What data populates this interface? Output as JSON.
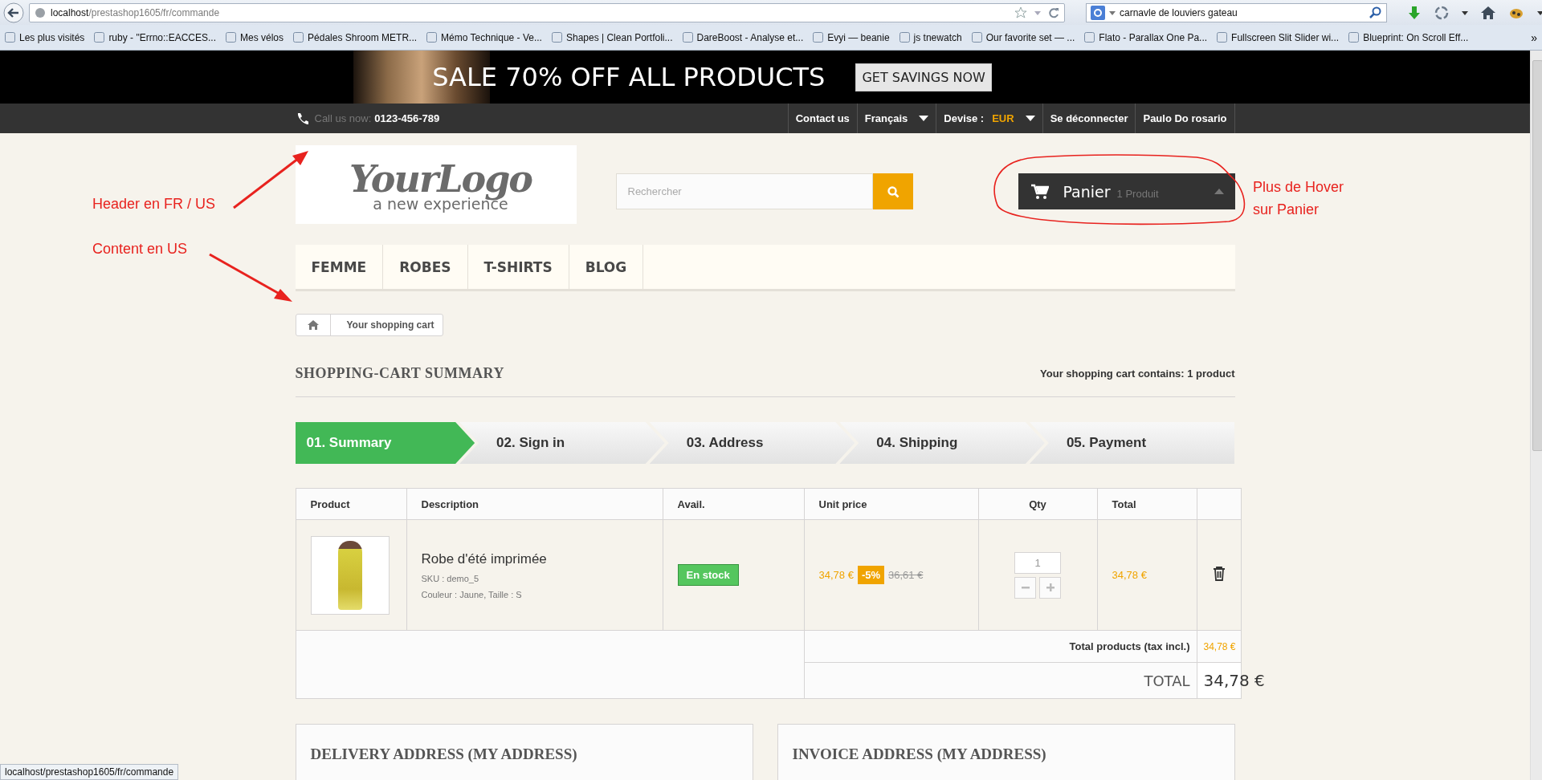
{
  "browser": {
    "url_host": "localhost",
    "url_path": "/prestashop1605/fr/commande",
    "search_query": "carnavle de louviers gateau",
    "bookmarks": [
      "Les plus visités",
      "ruby - \"Errno::EACCES...",
      "Mes vélos",
      "Pédales Shroom METR...",
      "Mémo Technique - Ve...",
      "Shapes | Clean Portfoli...",
      "DareBoost - Analyse et...",
      "Evyi — beanie",
      "js tnewatch",
      "Our favorite set — ...",
      "Flato - Parallax One Pa...",
      "Fullscreen Slit Slider wi...",
      "Blueprint: On Scroll Eff..."
    ],
    "more": "»"
  },
  "banner": {
    "text": "SALE 70% OFF ALL PRODUCTS",
    "button": "GET SAVINGS NOW"
  },
  "topbar": {
    "call_label": "Call us now:",
    "phone": "0123-456-789",
    "links": [
      {
        "kind": "link",
        "label": "Contact us"
      },
      {
        "kind": "dropdown",
        "label": "Français"
      },
      {
        "kind": "currency",
        "label": "Devise :",
        "value": "EUR"
      },
      {
        "kind": "link",
        "label": "Se déconnecter"
      },
      {
        "kind": "link",
        "label": "Paulo Do rosario"
      }
    ]
  },
  "logo": {
    "name": "YourLogo",
    "tagline": "a new experience"
  },
  "search": {
    "placeholder": "Rechercher"
  },
  "cart": {
    "label": "Panier",
    "count": "1 Produit"
  },
  "menu": [
    "FEMME",
    "ROBES",
    "T-SHIRTS",
    "BLOG"
  ],
  "breadcrumb": "Your shopping cart",
  "heading": "SHOPPING-CART SUMMARY",
  "cart_count_text": "Your shopping cart contains: 1 product",
  "steps": [
    {
      "label": "01. Summary",
      "selected": true
    },
    {
      "label": "02. Sign in",
      "selected": false
    },
    {
      "label": "03. Address",
      "selected": false
    },
    {
      "label": "04. Shipping",
      "selected": false
    },
    {
      "label": "05. Payment",
      "selected": false
    }
  ],
  "table": {
    "columns": [
      "Product",
      "Description",
      "Avail.",
      "Unit price",
      "Qty",
      "Total"
    ],
    "rows": [
      {
        "name": "Robe d'été imprimée",
        "sku": "SKU : demo_5",
        "attributes": "Couleur : Jaune, Taille : S",
        "availability": "En stock",
        "price": "34,78 €",
        "discount": "-5%",
        "old_price": "36,61 €",
        "qty": "1",
        "total": "34,78 €"
      }
    ],
    "totals": [
      {
        "kind": "subtotal",
        "label": "Total products (tax incl.)",
        "value": "34,78 €"
      },
      {
        "kind": "grand",
        "label": "TOTAL",
        "value": "34,78 €"
      }
    ]
  },
  "addresses": [
    "DELIVERY ADDRESS (MY ADDRESS)",
    "INVOICE ADDRESS (MY ADDRESS)"
  ],
  "status_bar": "localhost/prestashop1605/fr/commande",
  "annotations": [
    {
      "kind": "header",
      "text": "Header en FR / US"
    },
    {
      "kind": "content",
      "text": "Content en US"
    },
    {
      "kind": "cart",
      "text": "Plus de Hover sur Panier"
    }
  ]
}
